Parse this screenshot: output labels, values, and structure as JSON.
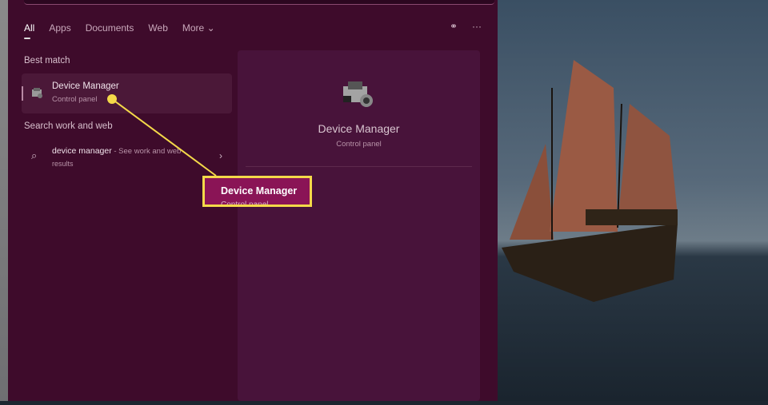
{
  "tabs": [
    "All",
    "Apps",
    "Documents",
    "Web",
    "More"
  ],
  "sections": {
    "best_match": "Best match",
    "search_web": "Search work and web"
  },
  "best_match": {
    "title": "Device Manager",
    "subtitle": "Control panel"
  },
  "web_result": {
    "query": "device manager",
    "suffix": " - See work and web",
    "suffix2": "results"
  },
  "preview": {
    "title": "Device Manager",
    "subtitle": "Control panel"
  },
  "callout": {
    "title": "Device Manager",
    "subtitle": "Control panel"
  },
  "colors": {
    "panel": "#3e0b2b",
    "highlight": "#f4d949",
    "callout_bg": "#8a1456"
  }
}
